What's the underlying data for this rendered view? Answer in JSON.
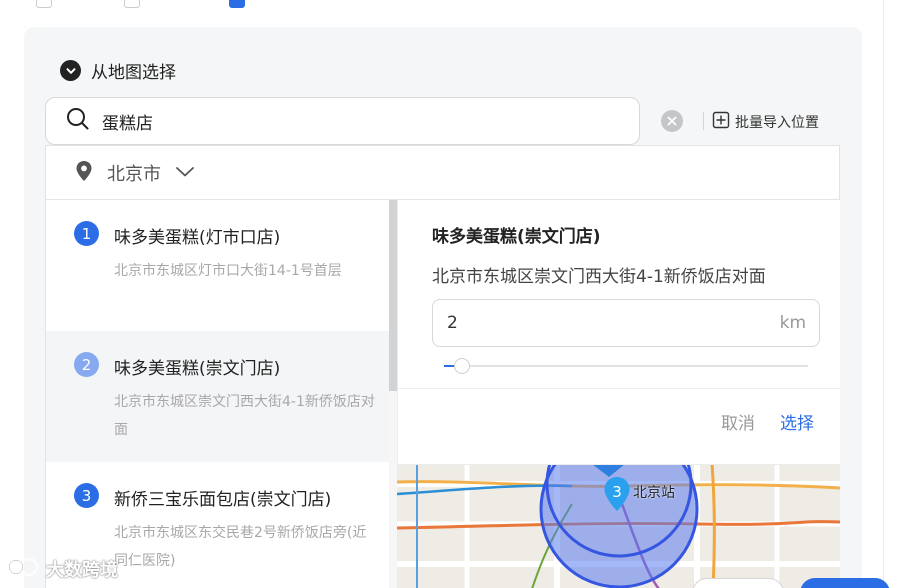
{
  "section": {
    "title": "从地图选择"
  },
  "search": {
    "value": "蛋糕店",
    "placeholder": ""
  },
  "toolbar": {
    "import_label": "批量导入位置"
  },
  "city": {
    "label": "北京市"
  },
  "results": [
    {
      "number": "1",
      "name": "味多美蛋糕(灯市口店)",
      "address": "北京市东城区灯市口大街14-1号首层"
    },
    {
      "number": "2",
      "name": "味多美蛋糕(崇文门店)",
      "address": "北京市东城区崇文门西大街4-1新侨饭店对面"
    },
    {
      "number": "3",
      "name": "新侨三宝乐面包店(崇文门店)",
      "address": "北京市东城区东交民巷2号新侨饭店旁(近同仁医院)"
    }
  ],
  "selected_index": 1,
  "detail": {
    "name": "味多美蛋糕(崇文门店)",
    "address": "北京市东城区崇文门西大街4-1新侨饭店对面",
    "radius": "2",
    "unit": "km",
    "slider_fraction": 0.05,
    "cancel_label": "取消",
    "confirm_label": "选择"
  },
  "map": {
    "marker_number": "3",
    "station_label": "北京站"
  },
  "watermark": {
    "text": "大数跨境"
  },
  "colors": {
    "accent": "#2b6de5",
    "panel_bg": "#f5f6f7",
    "radius_circle": "#5a7cf0"
  }
}
